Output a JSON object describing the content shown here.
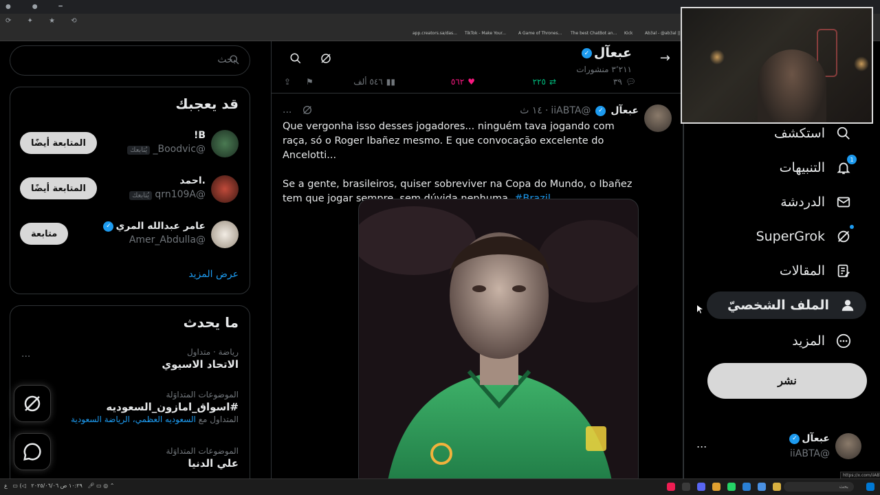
{
  "browser": {
    "bookmarks": [
      "app.creators.sa/das...",
      "TikTok - Make Your...",
      "A Game of Thrones...",
      "The best ChatBot an...",
      "Kick",
      "Ab3al - @ab3al ||..."
    ],
    "status_url": "https://x.com/iiABTA"
  },
  "sidebar": {
    "items": [
      {
        "label": "استكشف",
        "icon": "search-icon"
      },
      {
        "label": "التنبيهات",
        "icon": "bell-icon",
        "badge": "1"
      },
      {
        "label": "الدردشة",
        "icon": "mail-icon"
      },
      {
        "label": "SuperGrok",
        "icon": "grok-icon"
      },
      {
        "label": "المقالات",
        "icon": "article-icon"
      },
      {
        "label": "الملف الشخصيّ",
        "icon": "person-icon"
      },
      {
        "label": "المزيد",
        "icon": "more-circle-icon"
      }
    ],
    "post_label": "نشر",
    "account": {
      "name": "عبعآل",
      "handle": "@iiABTA",
      "more": "..."
    }
  },
  "header": {
    "title": "عبعآل",
    "subtitle": "٣٬٢١١ منشورات"
  },
  "prev_actions": {
    "replies": "٣٩",
    "reposts": "٢٢٥",
    "likes": "٥٦٢",
    "views": "٥٤٦ ألف"
  },
  "tweet": {
    "name": "عبعآل",
    "handle": "@iiABTA",
    "time": "١٤ ث",
    "separator": "·",
    "more": "...",
    "paragraph1": "Que vergonha isso desses jogadores... ninguém tava jogando com raça, só o Roger Ibañez mesmo. E que convocação excelente do Ancelotti...",
    "paragraph2": "Se a gente, brasileiros, quiser sobreviver na Copa do Mundo, o Ibañez tem que jogar sempre, sem dúvida nenhuma.",
    "hashtag": "#Brazil"
  },
  "search": {
    "placeholder": "بحث"
  },
  "who_to_follow": {
    "title": "قد يعجبك",
    "users": [
      {
        "name": "B!",
        "handle": "@Boodvic_",
        "follows_you": "يُتابعك",
        "button": "المتابعة أيضًا"
      },
      {
        "name": ".احمد",
        "handle": "@qrn109A",
        "follows_you": "يُتابعك",
        "button": "المتابعة أيضًا"
      },
      {
        "name": "عامر عبدالله المري",
        "handle": "@Amer_Abdulla",
        "follows_you": "",
        "button": "متابعة"
      }
    ],
    "show_more": "عرض المزيد"
  },
  "trends": {
    "title": "ما يحدث",
    "items": [
      {
        "category": "رياضة · متداول",
        "title": "الاتحاد الاسيوي",
        "sub": ""
      },
      {
        "category": "الموضوعات المتداوَلة",
        "title": "#اسواق_امازون_السعوديه",
        "sub_prefix": "المتداول مع",
        "sub": "السعوديه العظمي، الرياضة السعودية"
      },
      {
        "category": "الموضوعات المتداوَلة",
        "title": "علي الدنيا",
        "sub": ""
      }
    ],
    "more": "..."
  },
  "taskbar": {
    "clock": "١٠:٢٩ ص",
    "date": "٢٠٢٥/٠٦/٠٦",
    "lang": "ع",
    "search_placeholder": "بحث"
  },
  "colors": {
    "accent": "#1d9bf0",
    "like": "#f91880",
    "repost": "#00ba7c",
    "background": "#000000",
    "border": "#2f3336"
  }
}
